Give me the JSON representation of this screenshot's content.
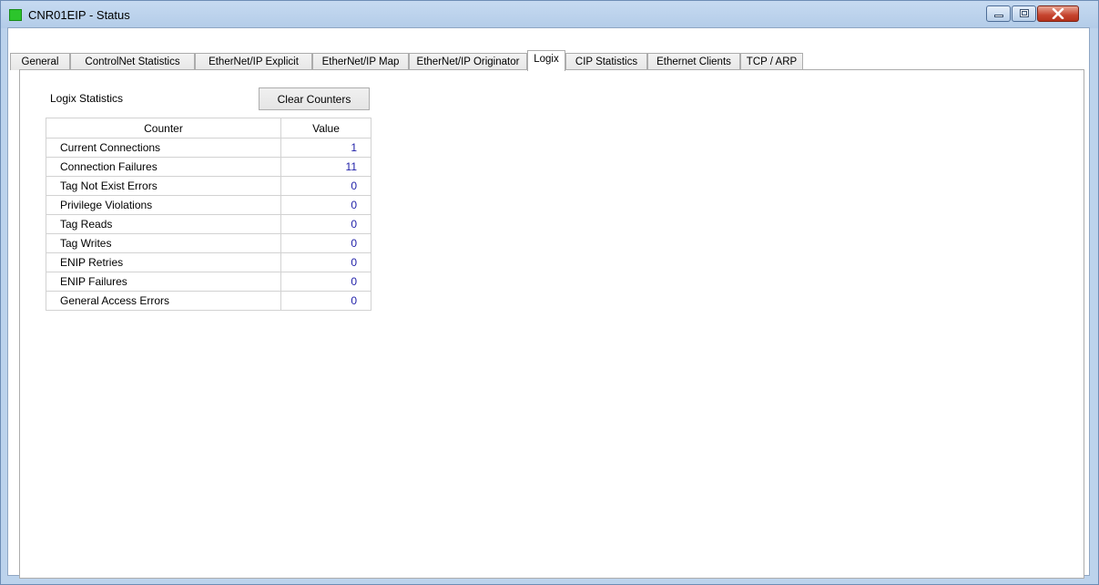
{
  "window": {
    "title": "CNR01EIP - Status",
    "icon_color": "#2cc52c"
  },
  "tabs": [
    {
      "label": "General"
    },
    {
      "label": "ControlNet Statistics"
    },
    {
      "label": "EtherNet/IP Explicit"
    },
    {
      "label": "EtherNet/IP Map"
    },
    {
      "label": "EtherNet/IP Originator"
    },
    {
      "label": "Logix",
      "active": true
    },
    {
      "label": "CIP Statistics"
    },
    {
      "label": "Ethernet Clients"
    },
    {
      "label": "TCP / ARP"
    }
  ],
  "logix": {
    "section_title": "Logix Statistics",
    "clear_button": "Clear Counters",
    "table": {
      "headers": [
        "Counter",
        "Value"
      ],
      "rows": [
        {
          "counter": "Current Connections",
          "value": "1"
        },
        {
          "counter": "Connection Failures",
          "value": "11"
        },
        {
          "counter": "Tag Not Exist Errors",
          "value": "0"
        },
        {
          "counter": "Privilege Violations",
          "value": "0"
        },
        {
          "counter": "Tag Reads",
          "value": "0"
        },
        {
          "counter": "Tag Writes",
          "value": "0"
        },
        {
          "counter": "ENIP Retries",
          "value": "0"
        },
        {
          "counter": "ENIP Failures",
          "value": "0"
        },
        {
          "counter": "General Access Errors",
          "value": "0"
        }
      ]
    }
  }
}
